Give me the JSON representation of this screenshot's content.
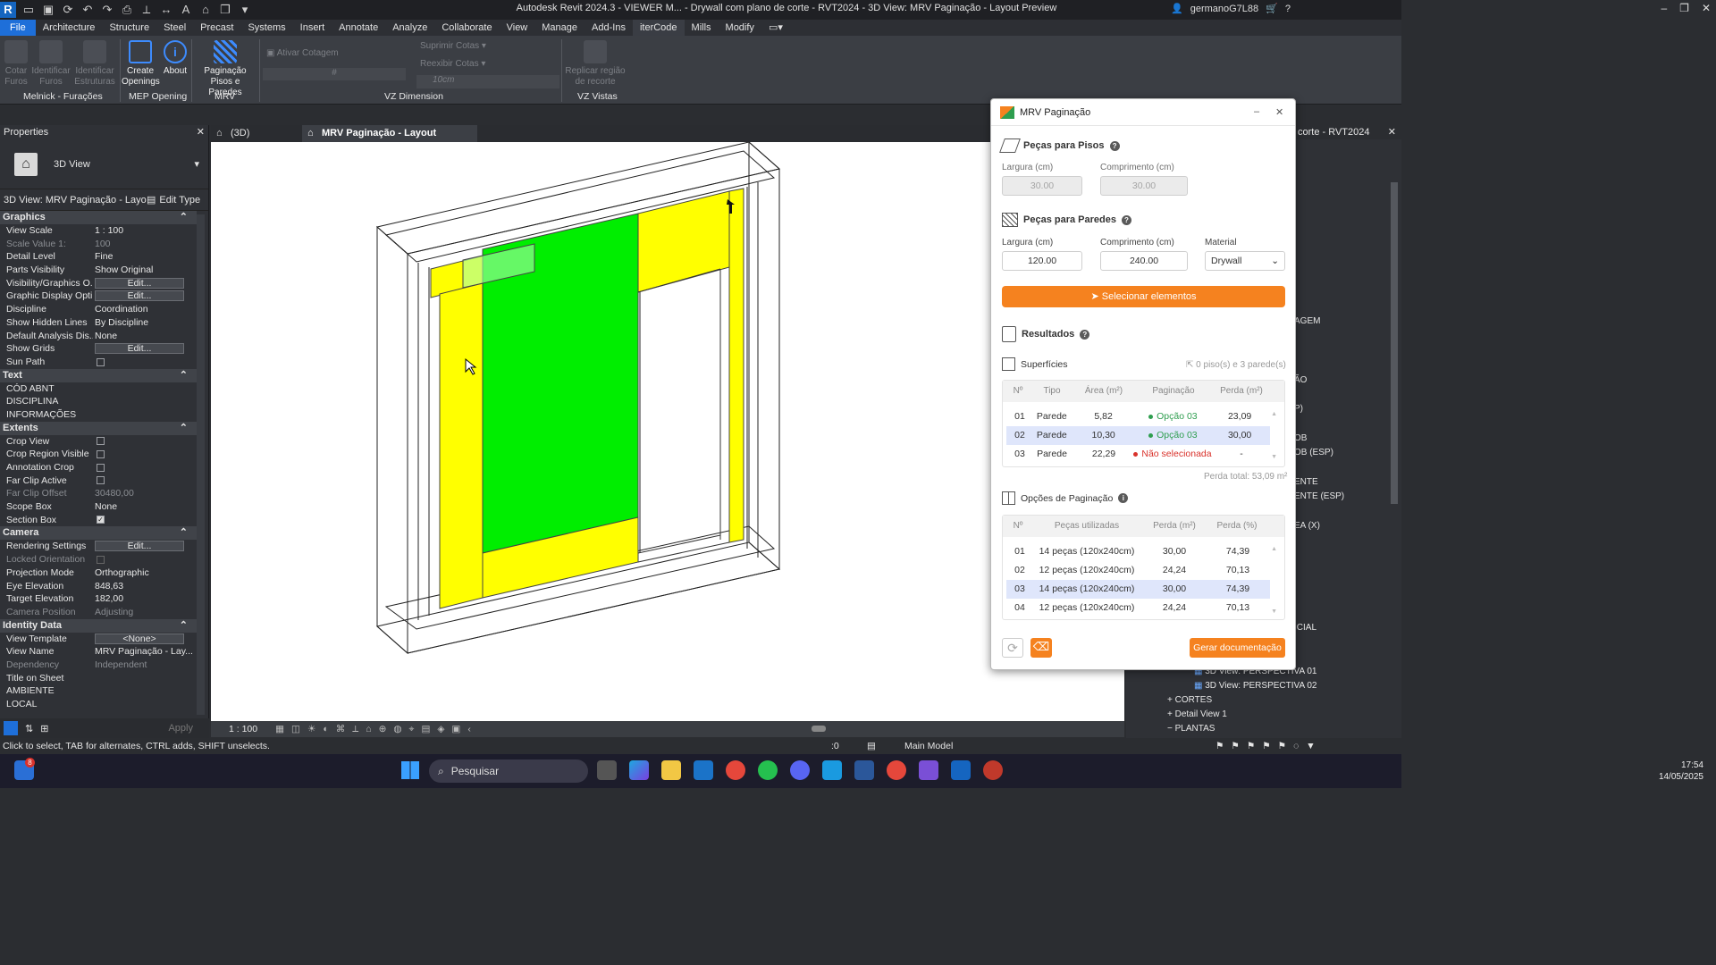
{
  "window": {
    "title": "Autodesk Revit 2024.3 - VIEWER M... - Drywall com plano de corte - RVT2024 - 3D View: MRV Paginação - Layout Preview",
    "user": "germanoG7L88"
  },
  "menu": [
    "File",
    "Architecture",
    "Structure",
    "Steel",
    "Precast",
    "Systems",
    "Insert",
    "Annotate",
    "Analyze",
    "Collaborate",
    "View",
    "Manage",
    "Add-Ins",
    "iterCode",
    "Mills",
    "Modify"
  ],
  "ribbon": {
    "cotar_furos": "Cotar Furos",
    "identificar_furos": "Identificar Furos",
    "identificar_estruturas": "Identificar Estruturas",
    "create_openings": "Create Openings",
    "about": "About",
    "paginacao": "Paginação Pisos e Paredes",
    "ativar_cotagem": "Ativar Cotagem",
    "suprimir_cotas": "Suprimir Cotas",
    "reexibir_cotas": "Reexibir Cotas",
    "spacing": "10cm",
    "replicar": "Replicar região de recorte",
    "groups": [
      "Melnick - Furações",
      "MEP Opening",
      "MRV",
      "VZ Dimension",
      "VZ Vistas"
    ]
  },
  "properties": {
    "title": "Properties",
    "type_name": "3D View",
    "selector": "3D View: MRV Paginação - Layout",
    "edit_type": "Edit Type",
    "apply": "Apply",
    "sections": {
      "graphics": "Graphics",
      "text": "Text",
      "extents": "Extents",
      "camera": "Camera",
      "identity": "Identity Data"
    },
    "rows": {
      "view_scale": [
        "View Scale",
        "1 : 100"
      ],
      "scale_value": [
        "Scale Value    1:",
        "100"
      ],
      "detail_level": [
        "Detail Level",
        "Fine"
      ],
      "parts_visibility": [
        "Parts Visibility",
        "Show Original"
      ],
      "vis_graphics": [
        "Visibility/Graphics O...",
        "Edit..."
      ],
      "graphic_display": [
        "Graphic Display Opti...",
        "Edit..."
      ],
      "discipline": [
        "Discipline",
        "Coordination"
      ],
      "hidden_lines": [
        "Show Hidden Lines",
        "By Discipline"
      ],
      "default_analysis": [
        "Default Analysis Dis...",
        "None"
      ],
      "show_grids": [
        "Show Grids",
        "Edit..."
      ],
      "sun_path": [
        "Sun Path",
        ""
      ],
      "cod_abnt": [
        "CÓD ABNT",
        ""
      ],
      "disciplina": [
        "DISCIPLINA",
        ""
      ],
      "informacoes": [
        "INFORMAÇÕES",
        ""
      ],
      "crop_view": [
        "Crop View",
        ""
      ],
      "crop_region": [
        "Crop Region Visible",
        ""
      ],
      "annotation_crop": [
        "Annotation Crop",
        ""
      ],
      "far_clip_active": [
        "Far Clip Active",
        ""
      ],
      "far_clip_offset": [
        "Far Clip Offset",
        "30480,00"
      ],
      "scope_box": [
        "Scope Box",
        "None"
      ],
      "section_box": [
        "Section Box",
        ""
      ],
      "rendering": [
        "Rendering Settings",
        "Edit..."
      ],
      "locked_orientation": [
        "Locked Orientation",
        ""
      ],
      "projection": [
        "Projection Mode",
        "Orthographic"
      ],
      "eye_elevation": [
        "Eye Elevation",
        "848,63"
      ],
      "target_elevation": [
        "Target Elevation",
        "182,00"
      ],
      "camera_position": [
        "Camera Position",
        "Adjusting"
      ],
      "view_template": [
        "View Template",
        "<None>"
      ],
      "view_name": [
        "View Name",
        "MRV Paginação - Lay..."
      ],
      "dependency": [
        "Dependency",
        "Independent"
      ],
      "title_on_sheet": [
        "Title on Sheet",
        ""
      ],
      "ambiente": [
        "AMBIENTE",
        ""
      ],
      "local": [
        "LOCAL",
        ""
      ]
    }
  },
  "view_tabs": [
    "(3D)",
    "MRV Paginação - Layout Preview"
  ],
  "view_bottom": {
    "scale": "1 : 100"
  },
  "status": {
    "hint": "Click to select, TAB for alternates, CTRL adds, SHIFT unselects.",
    "model": "Main Model",
    "count": ":0"
  },
  "right_panel": {
    "title": "corte - RVT2024",
    "items": [
      "AGEM",
      "ÃO",
      "P)",
      "OB",
      "OB (ESP)",
      "ENTE",
      "ENTE (ESP)",
      "EA (X)",
      "ICIAL"
    ],
    "tree": [
      "3D View: PERSPECTIVA 01",
      "3D View: PERSPECTIVA 02",
      "CORTES",
      "Detail View 1",
      "PLANTAS"
    ]
  },
  "dialog": {
    "title": "MRV Paginação",
    "pisos": {
      "title": "Peças para Pisos",
      "largura_label": "Largura (cm)",
      "largura": "30.00",
      "comprimento_label": "Comprimento (cm)",
      "comprimento": "30.00"
    },
    "paredes": {
      "title": "Peças para Paredes",
      "largura_label": "Largura (cm)",
      "largura": "120.00",
      "comprimento_label": "Comprimento (cm)",
      "comprimento": "240.00",
      "material_label": "Material",
      "material": "Drywall"
    },
    "select_button": "Selecionar elementos",
    "resultados": "Resultados",
    "superficies": {
      "title": "Superfícies",
      "summary": "0 piso(s) e 3 parede(s)",
      "headers": [
        "Nº",
        "Tipo",
        "Área (m²)",
        "Paginação",
        "Perda (m²)"
      ],
      "rows": [
        {
          "n": "01",
          "tipo": "Parede",
          "area": "5,82",
          "pag": "Opção 03",
          "perda": "23,09",
          "status": "ok"
        },
        {
          "n": "02",
          "tipo": "Parede",
          "area": "10,30",
          "pag": "Opção 03",
          "perda": "30,00",
          "status": "ok"
        },
        {
          "n": "03",
          "tipo": "Parede",
          "area": "22,29",
          "pag": "Não selecionada",
          "perda": "-",
          "status": "bad"
        }
      ],
      "total": "Perda total: 53,09 m²"
    },
    "opcoes": {
      "title": "Opções de Paginação",
      "headers": [
        "Nº",
        "Peças utilizadas",
        "Perda (m²)",
        "Perda (%)"
      ],
      "rows": [
        {
          "n": "01",
          "pecas": "14 peças (120x240cm)",
          "perda": "30,00",
          "pct": "74,39"
        },
        {
          "n": "02",
          "pecas": "12 peças (120x240cm)",
          "perda": "24,24",
          "pct": "70,13"
        },
        {
          "n": "03",
          "pecas": "14 peças (120x240cm)",
          "perda": "30,00",
          "pct": "74,39"
        },
        {
          "n": "04",
          "pecas": "12 peças (120x240cm)",
          "perda": "24,24",
          "pct": "70,13"
        }
      ]
    },
    "gerar_button": "Gerar documentação"
  },
  "taskbar": {
    "search": "Pesquisar",
    "time": "17:54",
    "date": "14/05/2025",
    "badge": "8"
  },
  "colors": {
    "accent_orange": "#f5821f",
    "revit_blue": "#1e6fd9",
    "wall_yellow": "#ffff00",
    "wall_green": "#00ee00"
  }
}
